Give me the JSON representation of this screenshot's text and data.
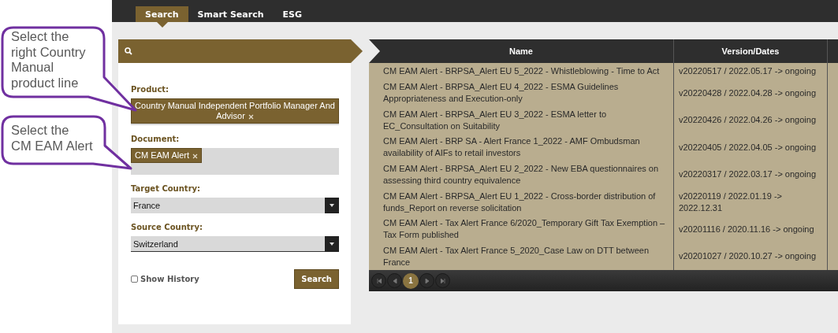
{
  "annotations": [
    {
      "lines": [
        "Select the",
        "right Country",
        "Manual",
        "product line"
      ]
    },
    {
      "lines": [
        "Select the",
        "CM EAM Alert"
      ]
    }
  ],
  "tabs": [
    {
      "label": "Search",
      "selected": true
    },
    {
      "label": "Smart Search",
      "selected": false
    },
    {
      "label": "ESG",
      "selected": false
    }
  ],
  "search_panel": {
    "product": {
      "label": "Product:",
      "tags": [
        "Country Manual Independent Portfolio Manager And Advisor"
      ]
    },
    "document": {
      "label": "Document:",
      "tags": [
        "CM EAM Alert"
      ]
    },
    "target_country": {
      "label": "Target Country:",
      "value": "France"
    },
    "source_country": {
      "label": "Source Country:",
      "value": "Switzerland"
    },
    "show_history": {
      "label": "Show History",
      "checked": false
    },
    "search_button": "Search"
  },
  "table": {
    "columns": [
      "Name",
      "Version/Dates"
    ],
    "rows": [
      {
        "name": "CM EAM Alert - BRPSA_Alert EU 5_2022 - Whistleblowing - Time to Act",
        "version": "v20220517 / 2022.05.17 -> ongoing"
      },
      {
        "name": "CM EAM Alert - BRPSA_Alert EU 4_2022 - ESMA Guidelines Appropriateness and Execution-only",
        "version": "v20220428 / 2022.04.28 -> ongoing"
      },
      {
        "name": "CM EAM Alert - BRPSA_Alert EU 3_2022 - ESMA letter to EC_Consultation on Suitability",
        "version": "v20220426 / 2022.04.26 -> ongoing"
      },
      {
        "name": "CM EAM Alert - BRP SA - Alert France 1_2022 - AMF Ombudsman availability of AIFs to retail investors",
        "version": "v20220405 / 2022.04.05 -> ongoing"
      },
      {
        "name": "CM EAM Alert - BRPSA_Alert EU 2_2022 - New EBA questionnaires on assessing third country equivalence",
        "version": "v20220317 / 2022.03.17 -> ongoing"
      },
      {
        "name": "CM EAM Alert - BRPSA_Alert EU 1_2022 - Cross-border distribution of funds_Report on reverse solicitation",
        "version": "v20220119 / 2022.01.19 -> 2022.12.31"
      },
      {
        "name": "CM EAM Alert - Tax Alert France 6/2020_Temporary Gift Tax Exemption – Tax Form published",
        "version": "v20201116 / 2020.11.16 -> ongoing"
      },
      {
        "name": "CM EAM Alert - Tax Alert France 5_2020_Case Law on DTT between France",
        "version": "v20201027 / 2020.10.27 -> ongoing"
      }
    ]
  },
  "pager": {
    "pages": [
      {
        "label": "1",
        "selected": true
      }
    ]
  }
}
